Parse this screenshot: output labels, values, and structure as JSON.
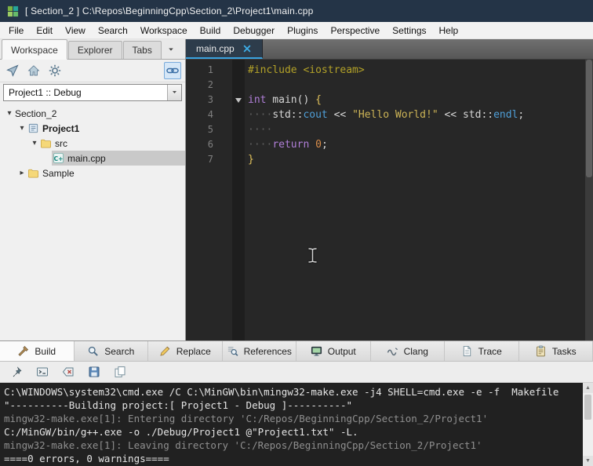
{
  "titlebar": {
    "title": "[ Section_2 ] C:\\Repos\\BeginningCpp\\Section_2\\Project1\\main.cpp",
    "app_icon": "codelite-logo-icon"
  },
  "menubar": {
    "items": [
      "File",
      "Edit",
      "View",
      "Search",
      "Workspace",
      "Build",
      "Debugger",
      "Plugins",
      "Perspective",
      "Settings",
      "Help"
    ]
  },
  "sidebar": {
    "tabs": [
      {
        "label": "Workspace",
        "active": true
      },
      {
        "label": "Explorer",
        "active": false
      },
      {
        "label": "Tabs",
        "active": false
      }
    ],
    "tab_overflow_icon": "chevron-down-icon",
    "toolbar_icons": [
      "locate-icon",
      "home-icon",
      "gear-icon",
      "link-icon"
    ],
    "link_toggled": true,
    "config_selector": {
      "value": "Project1 :: Debug"
    },
    "tree": [
      {
        "label": "Section_2",
        "level": 0,
        "arrow": "expanded",
        "icon": null,
        "bold": false,
        "selected": false
      },
      {
        "label": "Project1",
        "level": 1,
        "arrow": "expanded",
        "icon": "project",
        "bold": true,
        "selected": false
      },
      {
        "label": "src",
        "level": 2,
        "arrow": "expanded",
        "icon": "folder",
        "bold": false,
        "selected": false
      },
      {
        "label": "main.cpp",
        "level": 3,
        "arrow": "none",
        "icon": "cpp-file",
        "bold": false,
        "selected": true
      },
      {
        "label": "Sample",
        "level": 1,
        "arrow": "collapsed",
        "icon": "folder",
        "bold": false,
        "selected": false
      }
    ]
  },
  "editor": {
    "tabs": [
      {
        "label": "main.cpp",
        "active": true
      }
    ],
    "colors": {
      "background": "#272727",
      "line_number": "#808080",
      "preproc": "#b3a228",
      "keyword": "#b07fd8",
      "ident": "#4f9fd8",
      "string": "#cdb456",
      "number": "#d98d4a",
      "brace": "#e3c35c",
      "plain": "#d6d6d6",
      "ws": "#5f5f5f"
    },
    "code": {
      "lines": [
        {
          "num": 1,
          "fold": false,
          "segments": [
            {
              "text": "#include <iostream>",
              "style": "preproc"
            }
          ]
        },
        {
          "num": 2,
          "fold": false,
          "segments": []
        },
        {
          "num": 3,
          "fold": true,
          "segments": [
            {
              "text": "int",
              "style": "keyword"
            },
            {
              "text": " main() ",
              "style": "plain"
            },
            {
              "text": "{",
              "style": "brace"
            }
          ]
        },
        {
          "num": 4,
          "fold": false,
          "segments": [
            {
              "text": "····",
              "style": "ws"
            },
            {
              "text": "std::",
              "style": "plain"
            },
            {
              "text": "cout",
              "style": "ident"
            },
            {
              "text": " << ",
              "style": "plain"
            },
            {
              "text": "\"Hello World!\"",
              "style": "string"
            },
            {
              "text": " << ",
              "style": "plain"
            },
            {
              "text": "std::",
              "style": "plain"
            },
            {
              "text": "endl",
              "style": "ident"
            },
            {
              "text": ";",
              "style": "plain"
            }
          ]
        },
        {
          "num": 5,
          "fold": false,
          "segments": [
            {
              "text": "····",
              "style": "ws"
            }
          ]
        },
        {
          "num": 6,
          "fold": false,
          "segments": [
            {
              "text": "····",
              "style": "ws"
            },
            {
              "text": "return",
              "style": "keyword"
            },
            {
              "text": " ",
              "style": "plain"
            },
            {
              "text": "0",
              "style": "number"
            },
            {
              "text": ";",
              "style": "plain"
            }
          ]
        },
        {
          "num": 7,
          "fold": false,
          "segments": [
            {
              "text": "}",
              "style": "brace"
            }
          ]
        }
      ]
    }
  },
  "bottom_panel": {
    "tabs": [
      {
        "label": "Build",
        "icon": "hammer-icon",
        "active": true
      },
      {
        "label": "Search",
        "icon": "magnifier-icon",
        "active": false
      },
      {
        "label": "Replace",
        "icon": "pencil-icon",
        "active": false
      },
      {
        "label": "References",
        "icon": "references-icon",
        "active": false
      },
      {
        "label": "Output",
        "icon": "monitor-icon",
        "active": false
      },
      {
        "label": "Clang",
        "icon": "wave-icon",
        "active": false
      },
      {
        "label": "Trace",
        "icon": "document-icon",
        "active": false
      },
      {
        "label": "Tasks",
        "icon": "clipboard-icon",
        "active": false
      }
    ],
    "toolbar_icons": [
      "pin-icon",
      "terminal-icon",
      "clear-icon",
      "save-icon",
      "copy-icon"
    ],
    "console": {
      "lines": [
        {
          "text": "C:\\WINDOWS\\system32\\cmd.exe /C C:\\MinGW\\bin\\mingw32-make.exe -j4 SHELL=cmd.exe -e -f  Makefile",
          "dim": false
        },
        {
          "text": "\"----------Building project:[ Project1 - Debug ]----------\"",
          "dim": false
        },
        {
          "text": "mingw32-make.exe[1]: Entering directory 'C:/Repos/BeginningCpp/Section_2/Project1'",
          "dim": true
        },
        {
          "text": "C:/MinGW/bin/g++.exe -o ./Debug/Project1 @\"Project1.txt\" -L.",
          "dim": false
        },
        {
          "text": "mingw32-make.exe[1]: Leaving directory 'C:/Repos/BeginningCpp/Section_2/Project1'",
          "dim": true
        },
        {
          "text": "====0 errors, 0 warnings====",
          "dim": false
        }
      ]
    }
  }
}
